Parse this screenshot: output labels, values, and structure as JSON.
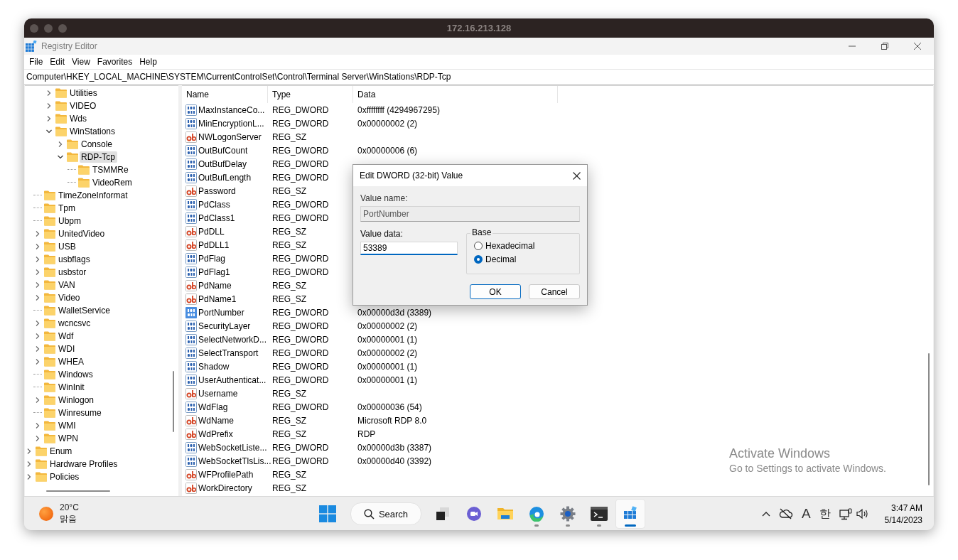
{
  "remote_window": {
    "title": "172.16.213.128"
  },
  "window": {
    "title": "Registry Editor"
  },
  "menu": [
    "File",
    "Edit",
    "View",
    "Favorites",
    "Help"
  ],
  "address": "Computer\\HKEY_LOCAL_MACHINE\\SYSTEM\\CurrentControlSet\\Control\\Terminal Server\\WinStations\\RDP-Tcp",
  "tree": {
    "items": [
      {
        "children": [
          {
            "children": [
              {
                "label": "Utilities",
                "expandable": true,
                "expanded": false,
                "selected": false
              },
              {
                "label": "VIDEO",
                "expandable": true,
                "expanded": false,
                "selected": false
              },
              {
                "label": "Wds",
                "expandable": true,
                "expanded": false,
                "selected": false
              },
              {
                "label": "WinStations",
                "expandable": true,
                "expanded": true,
                "selected": false,
                "children": [
                  {
                    "label": "Console",
                    "expandable": true,
                    "expanded": false,
                    "selected": false
                  },
                  {
                    "label": "RDP-Tcp",
                    "expandable": true,
                    "expanded": true,
                    "selected": true,
                    "children": [
                      {
                        "label": "TSMMRe",
                        "expandable": false,
                        "selected": false
                      },
                      {
                        "label": "VideoRem",
                        "expandable": false,
                        "selected": false
                      }
                    ]
                  }
                ]
              }
            ]
          },
          {
            "label": "TimeZoneInformat",
            "expandable": false,
            "selected": false
          },
          {
            "label": "Tpm",
            "expandable": false,
            "selected": false
          },
          {
            "label": "Ubpm",
            "expandable": false,
            "selected": false
          },
          {
            "label": "UnitedVideo",
            "expandable": true,
            "expanded": false,
            "selected": false
          },
          {
            "label": "USB",
            "expandable": true,
            "expanded": false,
            "selected": false
          },
          {
            "label": "usbflags",
            "expandable": true,
            "expanded": false,
            "selected": false
          },
          {
            "label": "usbstor",
            "expandable": true,
            "expanded": false,
            "selected": false
          },
          {
            "label": "VAN",
            "expandable": true,
            "expanded": false,
            "selected": false
          },
          {
            "label": "Video",
            "expandable": true,
            "expanded": false,
            "selected": false
          },
          {
            "label": "WalletService",
            "expandable": false,
            "selected": false
          },
          {
            "label": "wcncsvc",
            "expandable": true,
            "expanded": false,
            "selected": false
          },
          {
            "label": "Wdf",
            "expandable": true,
            "expanded": false,
            "selected": false
          },
          {
            "label": "WDI",
            "expandable": true,
            "expanded": false,
            "selected": false
          },
          {
            "label": "WHEA",
            "expandable": true,
            "expanded": false,
            "selected": false
          },
          {
            "label": "Windows",
            "expandable": false,
            "selected": false
          },
          {
            "label": "WinInit",
            "expandable": false,
            "selected": false
          },
          {
            "label": "Winlogon",
            "expandable": true,
            "expanded": false,
            "selected": false
          },
          {
            "label": "Winresume",
            "expandable": false,
            "selected": false
          },
          {
            "label": "WMI",
            "expandable": true,
            "expanded": false,
            "selected": false
          },
          {
            "label": "WPN",
            "expandable": true,
            "expanded": false,
            "selected": false
          }
        ]
      },
      {
        "label": "Enum",
        "expandable": true,
        "expanded": false,
        "selected": false
      },
      {
        "label": "Hardware Profiles",
        "expandable": true,
        "expanded": false,
        "selected": false
      },
      {
        "label": "Policies",
        "expandable": true,
        "expanded": false,
        "selected": false
      }
    ]
  },
  "values": {
    "columns": [
      "Name",
      "Type",
      "Data"
    ],
    "rows": [
      {
        "name": "MaxInstanceCo...",
        "type": "REG_DWORD",
        "data": "0xffffffff (4294967295)",
        "kind": "dword",
        "selected": false
      },
      {
        "name": "MinEncryptionL...",
        "type": "REG_DWORD",
        "data": "0x00000002 (2)",
        "kind": "dword",
        "selected": false
      },
      {
        "name": "NWLogonServer",
        "type": "REG_SZ",
        "kind": "string",
        "selected": false
      },
      {
        "name": "OutBufCount",
        "type": "REG_DWORD",
        "data": "0x00000006 (6)",
        "kind": "dword",
        "selected": false
      },
      {
        "name": "OutBufDelay",
        "type": "REG_DWORD",
        "kind": "dword",
        "selected": false
      },
      {
        "name": "OutBufLength",
        "type": "REG_DWORD",
        "kind": "dword",
        "selected": false
      },
      {
        "name": "Password",
        "type": "REG_SZ",
        "kind": "string",
        "selected": false
      },
      {
        "name": "PdClass",
        "type": "REG_DWORD",
        "kind": "dword",
        "selected": false
      },
      {
        "name": "PdClass1",
        "type": "REG_DWORD",
        "kind": "dword",
        "selected": false
      },
      {
        "name": "PdDLL",
        "type": "REG_SZ",
        "kind": "string",
        "selected": false
      },
      {
        "name": "PdDLL1",
        "type": "REG_SZ",
        "kind": "string",
        "selected": false
      },
      {
        "name": "PdFlag",
        "type": "REG_DWORD",
        "kind": "dword",
        "selected": false
      },
      {
        "name": "PdFlag1",
        "type": "REG_DWORD",
        "kind": "dword",
        "selected": false
      },
      {
        "name": "PdName",
        "type": "REG_SZ",
        "kind": "string",
        "selected": false
      },
      {
        "name": "PdName1",
        "type": "REG_SZ",
        "kind": "string",
        "selected": false
      },
      {
        "name": "PortNumber",
        "type": "REG_DWORD",
        "data": "0x00000d3d (3389)",
        "kind": "dword",
        "selected": true
      },
      {
        "name": "SecurityLayer",
        "type": "REG_DWORD",
        "data": "0x00000002 (2)",
        "kind": "dword",
        "selected": false
      },
      {
        "name": "SelectNetworkD...",
        "type": "REG_DWORD",
        "data": "0x00000001 (1)",
        "kind": "dword",
        "selected": false
      },
      {
        "name": "SelectTransport",
        "type": "REG_DWORD",
        "data": "0x00000002 (2)",
        "kind": "dword",
        "selected": false
      },
      {
        "name": "Shadow",
        "type": "REG_DWORD",
        "data": "0x00000001 (1)",
        "kind": "dword",
        "selected": false
      },
      {
        "name": "UserAuthenticat...",
        "type": "REG_DWORD",
        "data": "0x00000001 (1)",
        "kind": "dword",
        "selected": false
      },
      {
        "name": "Username",
        "type": "REG_SZ",
        "kind": "string",
        "selected": false
      },
      {
        "name": "WdFlag",
        "type": "REG_DWORD",
        "data": "0x00000036 (54)",
        "kind": "dword",
        "selected": false
      },
      {
        "name": "WdName",
        "type": "REG_SZ",
        "data": "Microsoft RDP 8.0",
        "kind": "string",
        "selected": false
      },
      {
        "name": "WdPrefix",
        "type": "REG_SZ",
        "data": "RDP",
        "kind": "string",
        "selected": false
      },
      {
        "name": "WebSocketListe...",
        "type": "REG_DWORD",
        "data": "0x00000d3b (3387)",
        "kind": "dword",
        "selected": false
      },
      {
        "name": "WebSocketTlsLis...",
        "type": "REG_DWORD",
        "data": "0x00000d40 (3392)",
        "kind": "dword",
        "selected": false
      },
      {
        "name": "WFProfilePath",
        "type": "REG_SZ",
        "kind": "string",
        "selected": false
      },
      {
        "name": "WorkDirectory",
        "type": "REG_SZ",
        "kind": "string",
        "selected": false
      }
    ]
  },
  "dialog": {
    "title": "Edit DWORD (32-bit) Value",
    "value_name_label": "Value name:",
    "value_name": "PortNumber",
    "value_data_label": "Value data:",
    "value_data": "53389",
    "base_label": "Base",
    "radios": [
      {
        "label": "Hexadecimal",
        "selected": false
      },
      {
        "label": "Decimal",
        "selected": true
      }
    ],
    "buttons": [
      {
        "label": "OK",
        "default": true
      },
      {
        "label": "Cancel",
        "default": false
      }
    ]
  },
  "activation": {
    "title": "Activate Windows",
    "message": "Go to Settings to activate Windows."
  },
  "taskbar": {
    "weather": {
      "temperature": "20°C",
      "condition": "맑음"
    },
    "search": {
      "label": "Search"
    },
    "apps": [
      {
        "running": false,
        "selected": false
      },
      {
        "running": false,
        "selected": false
      },
      {
        "running": false,
        "selected": false
      },
      {
        "running": true,
        "selected": false
      },
      {
        "running": true,
        "selected": false
      },
      {
        "running": true,
        "selected": false
      },
      {
        "running": true,
        "selected": true
      }
    ],
    "tray": {
      "input_mode": "A",
      "ime": "한",
      "time": "3:47 AM",
      "date": "5/14/2023"
    }
  }
}
